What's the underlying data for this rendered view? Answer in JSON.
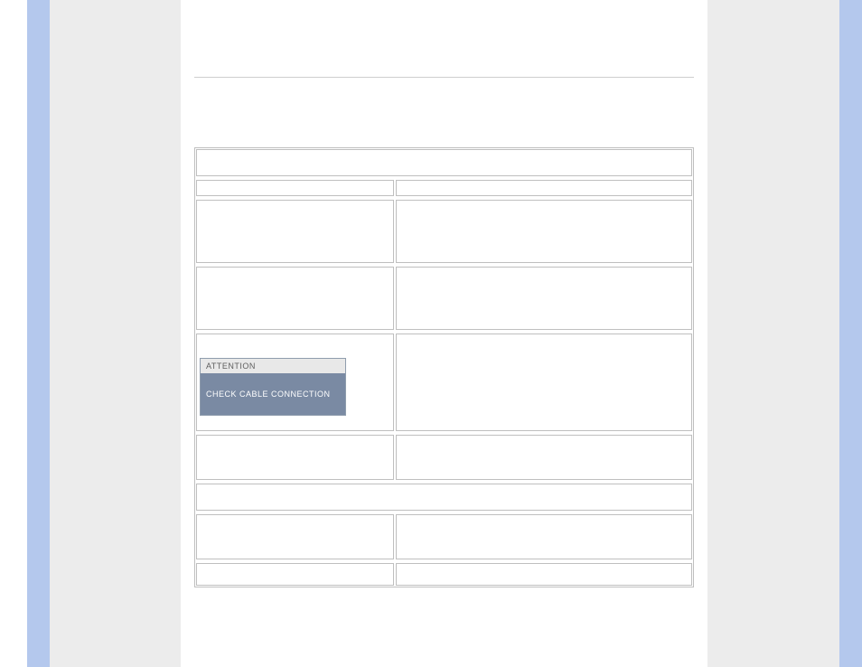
{
  "attention": {
    "header": "ATTENTION",
    "body": "CHECK CABLE CONNECTION"
  }
}
